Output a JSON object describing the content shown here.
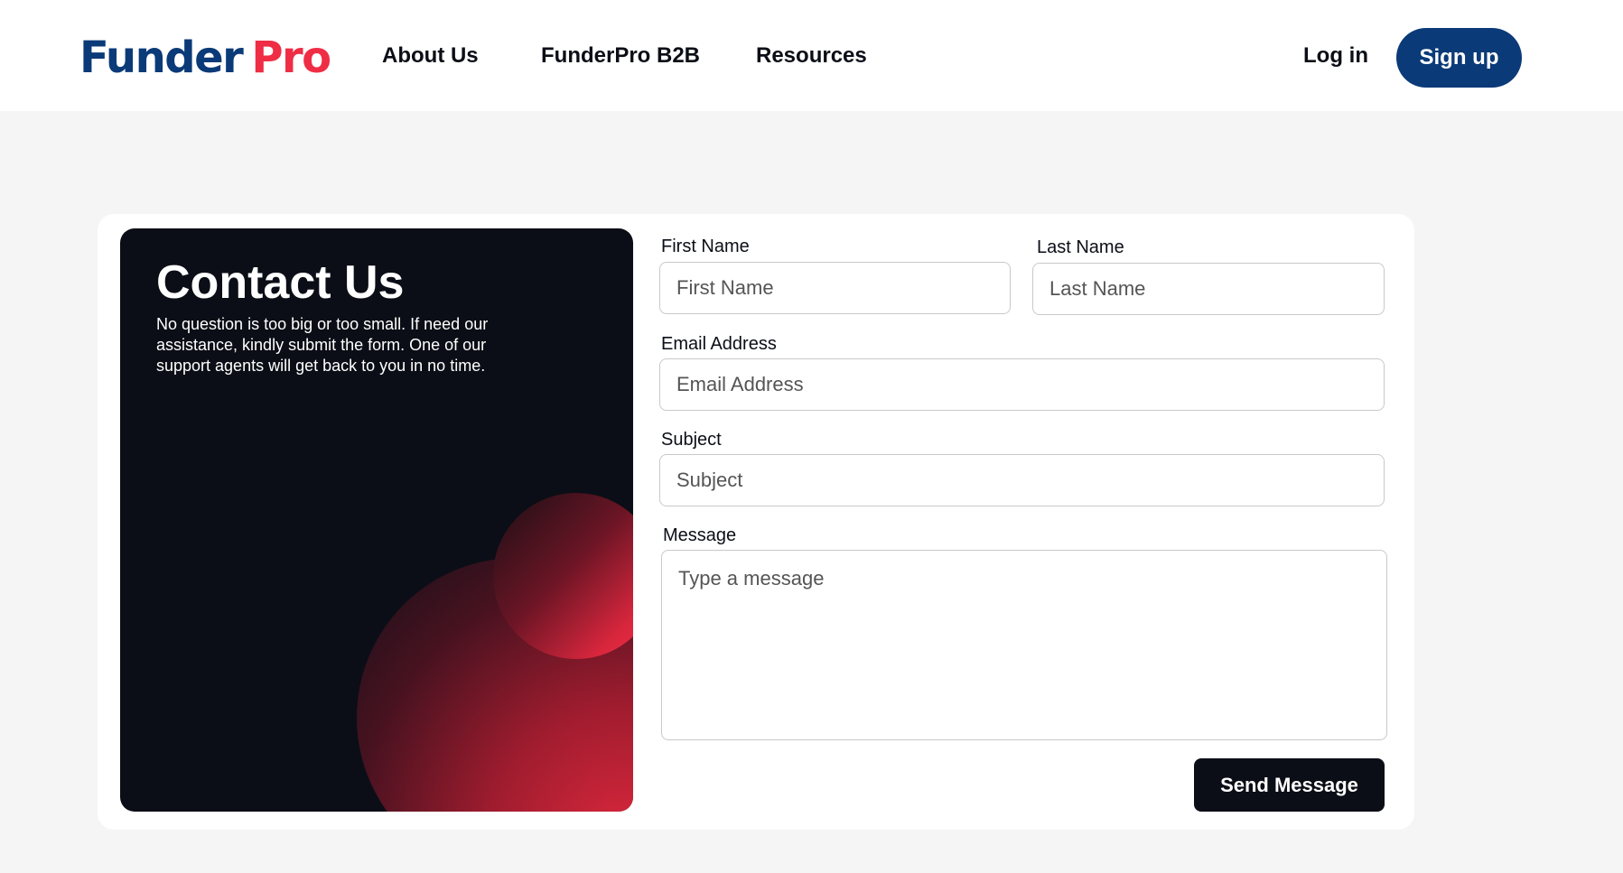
{
  "header": {
    "logo_part1": "Funder",
    "logo_part2": "Pro",
    "nav": [
      "About Us",
      "FunderPro B2B",
      "Resources"
    ],
    "login_label": "Log in",
    "signup_label": "Sign up"
  },
  "hero": {
    "title": "Contact Us",
    "description": "No question is too big or too small. If need our assistance, kindly submit the form. One of our support agents will get back to you in no time."
  },
  "form": {
    "first_name": {
      "label": "First Name",
      "placeholder": "First Name"
    },
    "last_name": {
      "label": "Last Name",
      "placeholder": "Last Name"
    },
    "email": {
      "label": "Email Address",
      "placeholder": "Email Address"
    },
    "subject": {
      "label": "Subject",
      "placeholder": "Subject"
    },
    "message": {
      "label": "Message",
      "placeholder": "Type a message"
    },
    "submit_label": "Send Message"
  },
  "colors": {
    "brand_navy": "#0b3a78",
    "brand_red": "#ef2d45",
    "dark": "#0b0e16"
  }
}
